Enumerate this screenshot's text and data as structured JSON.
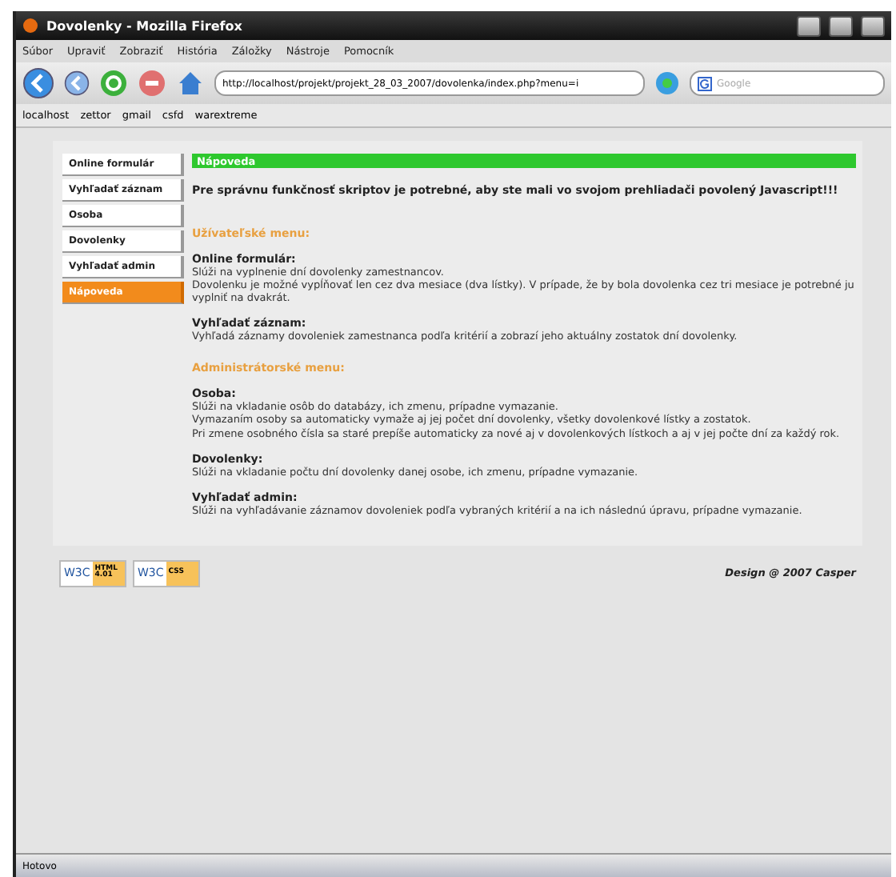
{
  "window": {
    "title": "Dovolenky - Mozilla Firefox"
  },
  "menu": [
    "Súbor",
    "Upraviť",
    "Zobraziť",
    "História",
    "Záložky",
    "Nástroje",
    "Pomocník"
  ],
  "toolbar": {
    "url": "http://localhost/projekt/projekt_28_03_2007/dovolenka/index.php?menu=i",
    "search_placeholder": "Google"
  },
  "bookmarks": [
    "localhost",
    "zettor",
    "gmail",
    "csfd",
    "warextreme"
  ],
  "sidebar": {
    "items": [
      {
        "label": "Online formulár",
        "selected": false
      },
      {
        "label": "Vyhľadať záznam",
        "selected": false
      },
      {
        "label": "Osoba",
        "selected": false
      },
      {
        "label": "Dovolenky",
        "selected": false
      },
      {
        "label": "Vyhľadať admin",
        "selected": false
      },
      {
        "label": "Nápoveda",
        "selected": true
      }
    ]
  },
  "content": {
    "heading": "Nápoveda",
    "intro": "Pre správnu funkčnosť skriptov je potrebné, aby ste mali vo svojom prehliadači povolený Javascript!!!",
    "blocks": [
      {
        "kind": "section",
        "text": "Užívateľské menu:"
      },
      {
        "kind": "entry",
        "title": "Online formulár:",
        "lines": [
          "Slúži na vyplnenie dní dovolenky zamestnancov.",
          "Dovolenku je možné vypĺňovať len cez dva mesiace (dva lístky). V prípade, že by bola dovolenka cez tri mesiace je potrebné ju vyplniť na dvakrát."
        ]
      },
      {
        "kind": "entry",
        "title": "Vyhľadať záznam:",
        "lines": [
          "Vyhľadá záznamy dovoleniek zamestnanca podľa kritérií a zobrazí jeho aktuálny zostatok dní dovolenky."
        ]
      },
      {
        "kind": "section",
        "text": "Administrátorské menu:"
      },
      {
        "kind": "entry",
        "title": "Osoba:",
        "lines": [
          "Slúži na vkladanie osôb do databázy, ich zmenu, prípadne vymazanie.",
          "Vymazaním osoby sa automaticky vymaže aj jej počet dní dovolenky, všetky dovolenkové lístky a zostatok.",
          "Pri zmene osobného čísla sa staré prepíše automaticky za nové aj v dovolenkových lístkoch a aj v jej počte dní za každý rok."
        ]
      },
      {
        "kind": "entry",
        "title": "Dovolenky:",
        "lines": [
          "Slúži na vkladanie počtu dní dovolenky danej osobe, ich zmenu, prípadne vymazanie."
        ]
      },
      {
        "kind": "entry",
        "title": "Vyhľadať admin:",
        "lines": [
          "Slúži na vyhľadávanie záznamov dovoleniek podľa vybraných kritérií a na ich následnú úpravu, prípadne vymazanie."
        ]
      }
    ]
  },
  "footer": {
    "badges": [
      {
        "logo": "W3C",
        "label": "HTML 4.01"
      },
      {
        "logo": "W3C",
        "label": "CSS"
      }
    ],
    "credit": "Design @ 2007 Casper"
  },
  "status_bar": "Hotovo"
}
